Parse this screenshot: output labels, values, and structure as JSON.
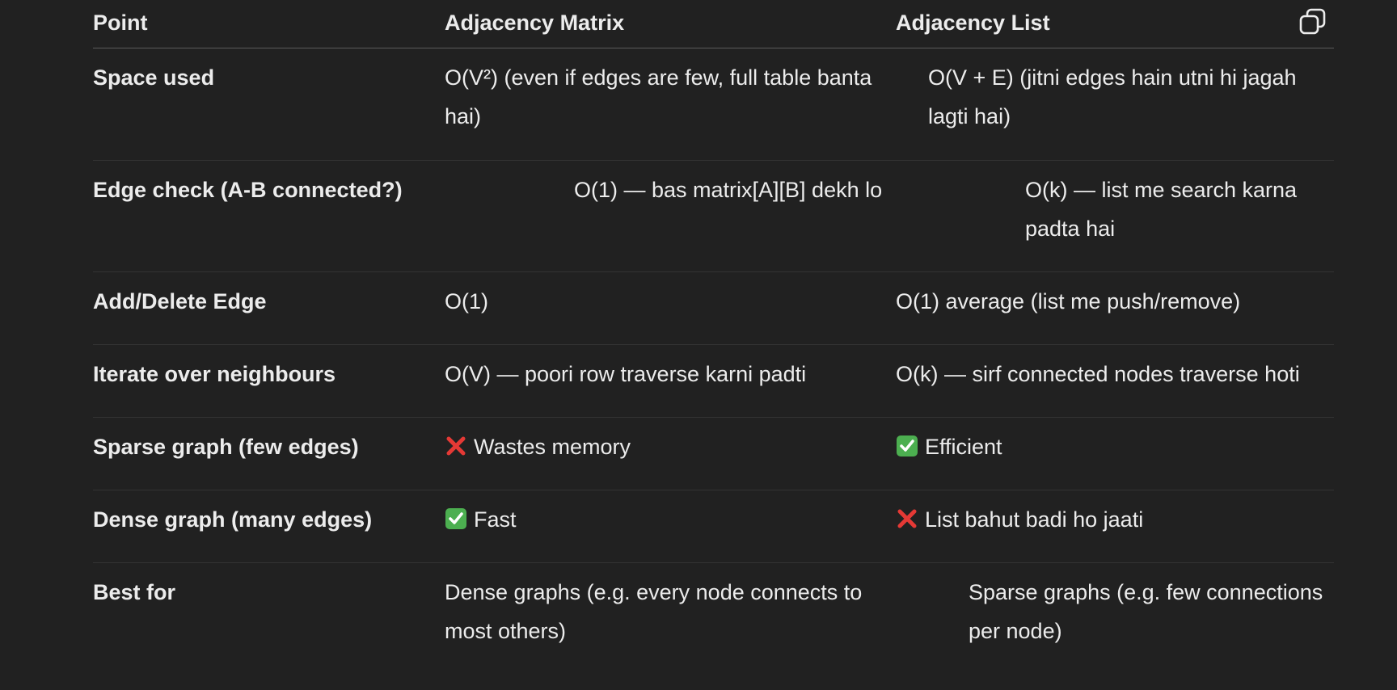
{
  "table": {
    "headers": [
      "Point",
      "Adjacency Matrix",
      "Adjacency List"
    ],
    "rows": [
      {
        "point": "Space used",
        "matrix": "O(V²) (even if edges are few, full table banta hai)",
        "list": "O(V + E) (jitni edges hain utni hi jagah lagti hai)"
      },
      {
        "point": "Edge check (A-B connected?)",
        "matrix": "O(1) — bas matrix[A][B] dekh lo",
        "list": "O(k) — list me search karna padta hai"
      },
      {
        "point": "Add/Delete Edge",
        "matrix": "O(1)",
        "list": "O(1) average (list me push/remove)"
      },
      {
        "point": "Iterate over neighbours",
        "matrix": "O(V) — poori row traverse karni padti",
        "list": "O(k) — sirf connected nodes traverse hoti"
      },
      {
        "point": "Sparse graph (few edges)",
        "matrix": "Wastes memory",
        "matrix_icon": "cross-mark-icon",
        "list": "Efficient",
        "list_icon": "check-mark-icon"
      },
      {
        "point": "Dense graph (many edges)",
        "matrix": "Fast",
        "matrix_icon": "check-mark-icon",
        "list": "List bahut badi ho jaati",
        "list_icon": "cross-mark-icon"
      },
      {
        "point": "Best for",
        "matrix": "Dense graphs (e.g. every node connects to most others)",
        "list": "Sparse graphs (e.g. few connections per node)"
      }
    ]
  },
  "icons": {
    "copy": "copy-icon",
    "check": "check-mark-icon",
    "cross": "cross-mark-icon"
  },
  "colors": {
    "background": "#212121",
    "text": "#ececec",
    "check_bg": "#4caf50",
    "cross": "#e53935"
  }
}
